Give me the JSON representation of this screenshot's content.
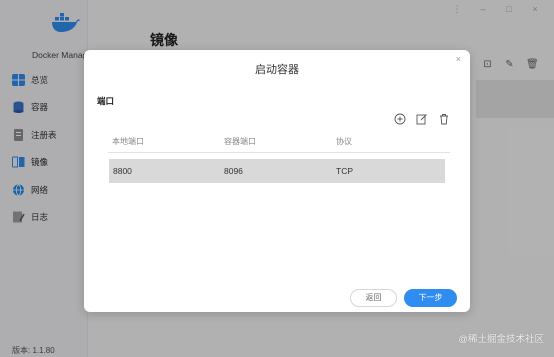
{
  "app": {
    "name": "Docker Manager",
    "version": "版本: 1.1.80",
    "page_title": "镜像"
  },
  "sidebar": {
    "items": [
      {
        "label": "总览",
        "icon": "overview-icon",
        "color": "#2f8cf0"
      },
      {
        "label": "容器",
        "icon": "container-icon",
        "color": "#3a72c8"
      },
      {
        "label": "注册表",
        "icon": "registry-icon",
        "color": "#8e8e8e"
      },
      {
        "label": "镜像",
        "icon": "image-icon",
        "color": "#2f8cf0",
        "active": true
      },
      {
        "label": "网络",
        "icon": "network-icon",
        "color": "#1e88e5"
      },
      {
        "label": "日志",
        "icon": "log-icon",
        "color": "#9e9e9e"
      }
    ]
  },
  "modal": {
    "title": "启动容器",
    "close": "×",
    "section": "端口",
    "columns": [
      "本地端口",
      "容器端口",
      "协议"
    ],
    "rows": [
      {
        "local": "8800",
        "container": "8096",
        "protocol": "TCP"
      }
    ],
    "back_label": "返回",
    "next_label": "下一步"
  },
  "watermark": "@稀土掘金技术社区",
  "colors": {
    "accent": "#2f8cf0"
  }
}
